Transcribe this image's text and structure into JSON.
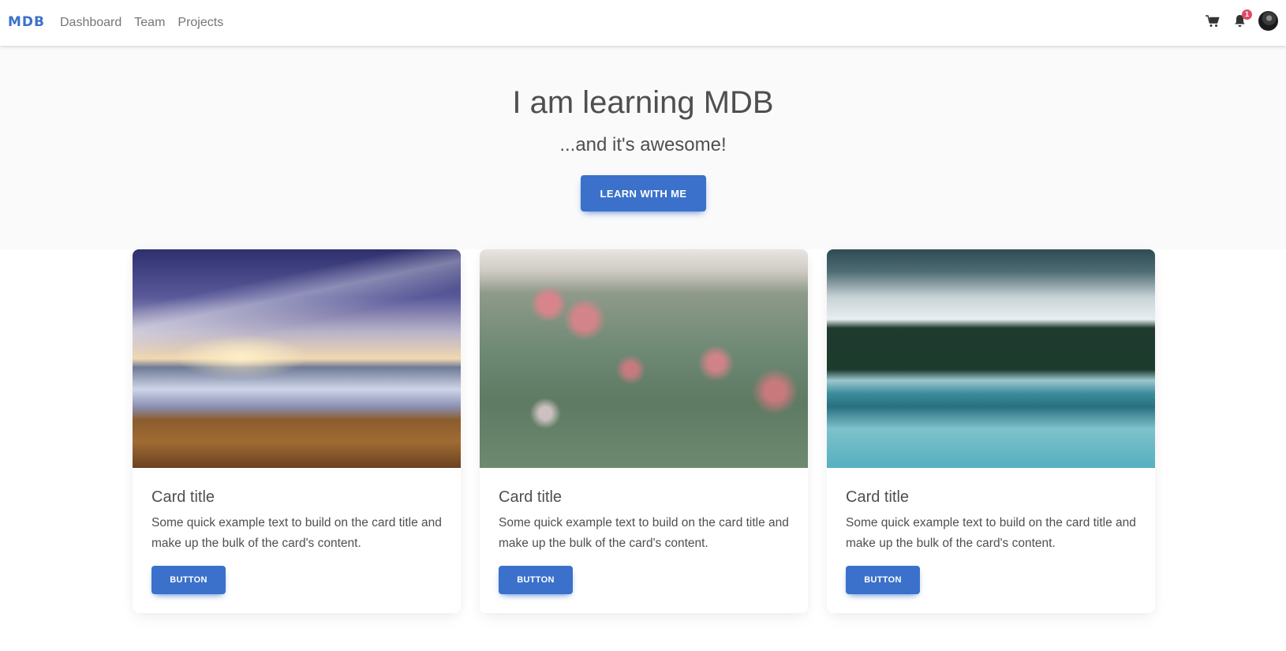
{
  "navbar": {
    "brand": "MDB",
    "links": [
      "Dashboard",
      "Team",
      "Projects"
    ],
    "notification_count": "1"
  },
  "hero": {
    "title": "I am learning MDB",
    "subtitle": "...and it's awesome!",
    "button_label": "LEARN WITH ME"
  },
  "cards": [
    {
      "image": "beach-sunset",
      "title": "Card title",
      "text": "Some quick example text to build on the card title and make up the bulk of the card's content.",
      "button_label": "BUTTON"
    },
    {
      "image": "pink-wildflowers",
      "title": "Card title",
      "text": "Some quick example text to build on the card title and make up the bulk of the card's content.",
      "button_label": "BUTTON"
    },
    {
      "image": "misty-forest-lake",
      "title": "Card title",
      "text": "Some quick example text to build on the card title and make up the bulk of the card's content.",
      "button_label": "BUTTON"
    }
  ],
  "colors": {
    "primary": "#3b71ca",
    "badge": "#dc4c64",
    "text": "#4f4f4f",
    "hero_bg": "#fafafa"
  },
  "icons": [
    "cart-icon",
    "bell-icon",
    "avatar"
  ]
}
